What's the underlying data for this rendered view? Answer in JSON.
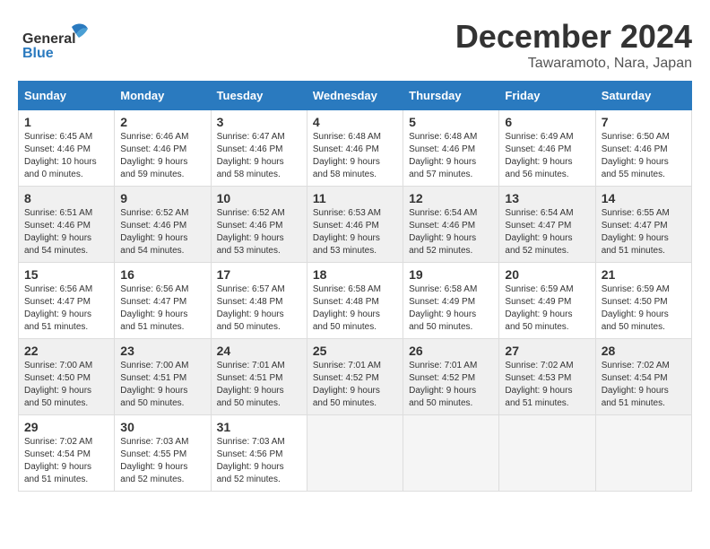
{
  "logo": {
    "line1": "General",
    "line2": "Blue"
  },
  "title": "December 2024",
  "subtitle": "Tawaramoto, Nara, Japan",
  "days_header": [
    "Sunday",
    "Monday",
    "Tuesday",
    "Wednesday",
    "Thursday",
    "Friday",
    "Saturday"
  ],
  "weeks": [
    [
      {
        "day": "1",
        "sunrise": "6:45 AM",
        "sunset": "4:46 PM",
        "daylight": "10 hours and 0 minutes."
      },
      {
        "day": "2",
        "sunrise": "6:46 AM",
        "sunset": "4:46 PM",
        "daylight": "9 hours and 59 minutes."
      },
      {
        "day": "3",
        "sunrise": "6:47 AM",
        "sunset": "4:46 PM",
        "daylight": "9 hours and 58 minutes."
      },
      {
        "day": "4",
        "sunrise": "6:48 AM",
        "sunset": "4:46 PM",
        "daylight": "9 hours and 58 minutes."
      },
      {
        "day": "5",
        "sunrise": "6:48 AM",
        "sunset": "4:46 PM",
        "daylight": "9 hours and 57 minutes."
      },
      {
        "day": "6",
        "sunrise": "6:49 AM",
        "sunset": "4:46 PM",
        "daylight": "9 hours and 56 minutes."
      },
      {
        "day": "7",
        "sunrise": "6:50 AM",
        "sunset": "4:46 PM",
        "daylight": "9 hours and 55 minutes."
      }
    ],
    [
      {
        "day": "8",
        "sunrise": "6:51 AM",
        "sunset": "4:46 PM",
        "daylight": "9 hours and 54 minutes."
      },
      {
        "day": "9",
        "sunrise": "6:52 AM",
        "sunset": "4:46 PM",
        "daylight": "9 hours and 54 minutes."
      },
      {
        "day": "10",
        "sunrise": "6:52 AM",
        "sunset": "4:46 PM",
        "daylight": "9 hours and 53 minutes."
      },
      {
        "day": "11",
        "sunrise": "6:53 AM",
        "sunset": "4:46 PM",
        "daylight": "9 hours and 53 minutes."
      },
      {
        "day": "12",
        "sunrise": "6:54 AM",
        "sunset": "4:46 PM",
        "daylight": "9 hours and 52 minutes."
      },
      {
        "day": "13",
        "sunrise": "6:54 AM",
        "sunset": "4:47 PM",
        "daylight": "9 hours and 52 minutes."
      },
      {
        "day": "14",
        "sunrise": "6:55 AM",
        "sunset": "4:47 PM",
        "daylight": "9 hours and 51 minutes."
      }
    ],
    [
      {
        "day": "15",
        "sunrise": "6:56 AM",
        "sunset": "4:47 PM",
        "daylight": "9 hours and 51 minutes."
      },
      {
        "day": "16",
        "sunrise": "6:56 AM",
        "sunset": "4:47 PM",
        "daylight": "9 hours and 51 minutes."
      },
      {
        "day": "17",
        "sunrise": "6:57 AM",
        "sunset": "4:48 PM",
        "daylight": "9 hours and 50 minutes."
      },
      {
        "day": "18",
        "sunrise": "6:58 AM",
        "sunset": "4:48 PM",
        "daylight": "9 hours and 50 minutes."
      },
      {
        "day": "19",
        "sunrise": "6:58 AM",
        "sunset": "4:49 PM",
        "daylight": "9 hours and 50 minutes."
      },
      {
        "day": "20",
        "sunrise": "6:59 AM",
        "sunset": "4:49 PM",
        "daylight": "9 hours and 50 minutes."
      },
      {
        "day": "21",
        "sunrise": "6:59 AM",
        "sunset": "4:50 PM",
        "daylight": "9 hours and 50 minutes."
      }
    ],
    [
      {
        "day": "22",
        "sunrise": "7:00 AM",
        "sunset": "4:50 PM",
        "daylight": "9 hours and 50 minutes."
      },
      {
        "day": "23",
        "sunrise": "7:00 AM",
        "sunset": "4:51 PM",
        "daylight": "9 hours and 50 minutes."
      },
      {
        "day": "24",
        "sunrise": "7:01 AM",
        "sunset": "4:51 PM",
        "daylight": "9 hours and 50 minutes."
      },
      {
        "day": "25",
        "sunrise": "7:01 AM",
        "sunset": "4:52 PM",
        "daylight": "9 hours and 50 minutes."
      },
      {
        "day": "26",
        "sunrise": "7:01 AM",
        "sunset": "4:52 PM",
        "daylight": "9 hours and 50 minutes."
      },
      {
        "day": "27",
        "sunrise": "7:02 AM",
        "sunset": "4:53 PM",
        "daylight": "9 hours and 51 minutes."
      },
      {
        "day": "28",
        "sunrise": "7:02 AM",
        "sunset": "4:54 PM",
        "daylight": "9 hours and 51 minutes."
      }
    ],
    [
      {
        "day": "29",
        "sunrise": "7:02 AM",
        "sunset": "4:54 PM",
        "daylight": "9 hours and 51 minutes."
      },
      {
        "day": "30",
        "sunrise": "7:03 AM",
        "sunset": "4:55 PM",
        "daylight": "9 hours and 52 minutes."
      },
      {
        "day": "31",
        "sunrise": "7:03 AM",
        "sunset": "4:56 PM",
        "daylight": "9 hours and 52 minutes."
      },
      null,
      null,
      null,
      null
    ]
  ]
}
